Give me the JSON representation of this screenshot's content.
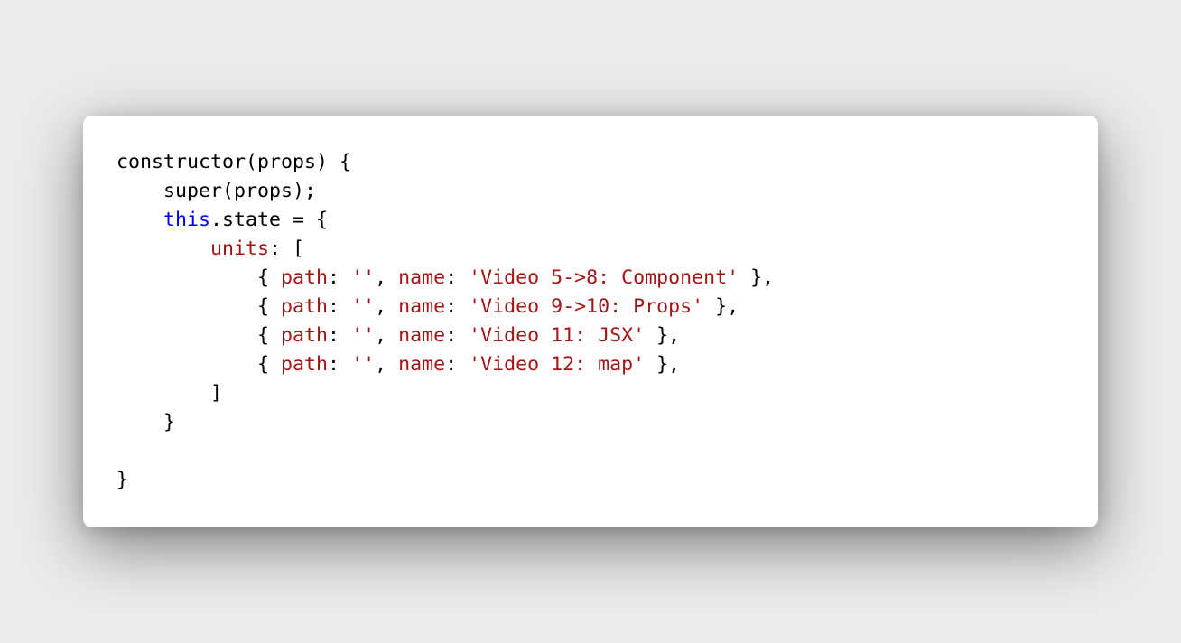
{
  "code_lines": [
    {
      "indent": "",
      "tokens": [
        {
          "t": "plain",
          "v": "constructor(props) {"
        }
      ]
    },
    {
      "indent": "    ",
      "tokens": [
        {
          "t": "plain",
          "v": "super(props);"
        }
      ]
    },
    {
      "indent": "    ",
      "tokens": [
        {
          "t": "kw",
          "v": "this"
        },
        {
          "t": "plain",
          "v": ".state = {"
        }
      ]
    },
    {
      "indent": "        ",
      "tokens": [
        {
          "t": "prop",
          "v": "units"
        },
        {
          "t": "plain",
          "v": ": ["
        }
      ]
    },
    {
      "indent": "            ",
      "tokens": [
        {
          "t": "plain",
          "v": "{ "
        },
        {
          "t": "prop",
          "v": "path"
        },
        {
          "t": "plain",
          "v": ": "
        },
        {
          "t": "str",
          "v": "''"
        },
        {
          "t": "plain",
          "v": ", "
        },
        {
          "t": "prop",
          "v": "name"
        },
        {
          "t": "plain",
          "v": ": "
        },
        {
          "t": "str",
          "v": "'Video 5->8: Component'"
        },
        {
          "t": "plain",
          "v": " },"
        }
      ]
    },
    {
      "indent": "            ",
      "tokens": [
        {
          "t": "plain",
          "v": "{ "
        },
        {
          "t": "prop",
          "v": "path"
        },
        {
          "t": "plain",
          "v": ": "
        },
        {
          "t": "str",
          "v": "''"
        },
        {
          "t": "plain",
          "v": ", "
        },
        {
          "t": "prop",
          "v": "name"
        },
        {
          "t": "plain",
          "v": ": "
        },
        {
          "t": "str",
          "v": "'Video 9->10: Props'"
        },
        {
          "t": "plain",
          "v": " },"
        }
      ]
    },
    {
      "indent": "            ",
      "tokens": [
        {
          "t": "plain",
          "v": "{ "
        },
        {
          "t": "prop",
          "v": "path"
        },
        {
          "t": "plain",
          "v": ": "
        },
        {
          "t": "str",
          "v": "''"
        },
        {
          "t": "plain",
          "v": ", "
        },
        {
          "t": "prop",
          "v": "name"
        },
        {
          "t": "plain",
          "v": ": "
        },
        {
          "t": "str",
          "v": "'Video 11: JSX'"
        },
        {
          "t": "plain",
          "v": " },"
        }
      ]
    },
    {
      "indent": "            ",
      "tokens": [
        {
          "t": "plain",
          "v": "{ "
        },
        {
          "t": "prop",
          "v": "path"
        },
        {
          "t": "plain",
          "v": ": "
        },
        {
          "t": "str",
          "v": "''"
        },
        {
          "t": "plain",
          "v": ", "
        },
        {
          "t": "prop",
          "v": "name"
        },
        {
          "t": "plain",
          "v": ": "
        },
        {
          "t": "str",
          "v": "'Video 12: map'"
        },
        {
          "t": "plain",
          "v": " },"
        }
      ]
    },
    {
      "indent": "        ",
      "tokens": [
        {
          "t": "plain",
          "v": "]"
        }
      ]
    },
    {
      "indent": "    ",
      "tokens": [
        {
          "t": "plain",
          "v": "}"
        }
      ]
    },
    {
      "indent": "",
      "tokens": []
    },
    {
      "indent": "",
      "tokens": [
        {
          "t": "plain",
          "v": "}"
        }
      ]
    }
  ],
  "colors": {
    "keyword": "#0000ff",
    "property": "#a31515",
    "string": "#a31515",
    "text": "#000000",
    "card_background": "#ffffff",
    "page_background": "#ececec"
  }
}
